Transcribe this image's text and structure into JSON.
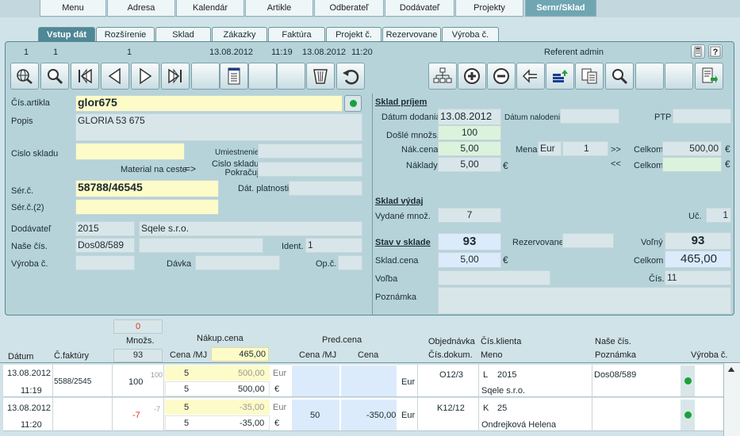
{
  "top_tabs": [
    {
      "label": "Menu"
    },
    {
      "label": "Adresa"
    },
    {
      "label": "Kalendár"
    },
    {
      "label": "Artikle"
    },
    {
      "label": "Odberateľ"
    },
    {
      "label": "Dodávateľ"
    },
    {
      "label": "Projekty"
    },
    {
      "label": "Sernr/Sklad"
    }
  ],
  "sub_tabs": [
    {
      "label": "Vstup dát"
    },
    {
      "label": "Rozšírenie"
    },
    {
      "label": "Sklad"
    },
    {
      "label": "Zákazky"
    },
    {
      "label": "Faktúra"
    },
    {
      "label": "Projekt č."
    },
    {
      "label": "Rezervovane"
    },
    {
      "label": "Výroba č."
    }
  ],
  "header": {
    "n1": "1",
    "n2": "1",
    "n3": "1",
    "date1": "13.08.2012",
    "time1": "11:19",
    "date2": "13.08.2012",
    "time2": "11:20",
    "referent_label": "Referent",
    "referent": "admin"
  },
  "icons": {
    "left": [
      "globe-search-icon",
      "search-icon",
      "first-record-icon",
      "prev-record-icon",
      "next-record-icon",
      "last-record-icon",
      "empty-icon",
      "document-list-icon",
      "empty-icon",
      "empty-icon",
      "trash-icon",
      "undo-icon"
    ],
    "right": [
      "tree-icon",
      "add-icon",
      "remove-icon",
      "arrow-back-icon",
      "stack-up-icon",
      "copy-docs-icon",
      "search-icon",
      "empty-icon",
      "empty-icon",
      "export-icon"
    ]
  },
  "form": {
    "cis_artikla_label": "Čís.artikla",
    "cis_artikla": "glor675",
    "popis_label": "Popis",
    "popis": "GLORIA 53 675",
    "cislo_skladu_label": "Cislo skladu",
    "cislo_skladu": "",
    "umiestnenie_label": "Umiestnenie",
    "umiestnenie": "",
    "material_label": "Material na ceste",
    "material_arrow": "=>",
    "cislo_skladu2_label": "Cislo skladu",
    "pokracuj_label": "Pokračuj",
    "cislo_skladu2": "",
    "ser_label": "Sér.č.",
    "ser": "58788/46545",
    "dat_platnosti_label": "Dát. platnosti",
    "dat_platnosti": "",
    "ser2_label": "Sér.č.(2)",
    "ser2": "",
    "dodavatel_label": "Dodávateľ",
    "dodavatel_cis": "2015",
    "dodavatel_name": "Sqele s.r.o.",
    "nase_cis_label": "Naše čís.",
    "nase_cis": "Dos08/589",
    "ident_label": "Ident.",
    "ident": "1",
    "vyroba_label": "Výroba č.",
    "vyroba": "",
    "davka_label": "Dávka",
    "davka": "",
    "opc_label": "Op.č.",
    "opc": ""
  },
  "prijem": {
    "title": "Sklad príjem",
    "datum_dodania_label": "Dátum dodania",
    "datum_dodania": "13.08.2012",
    "datum_nalodenia_label": "Dátum nalodenia",
    "datum_nalodenia": "",
    "ptp_label": "PTP",
    "ptp": "",
    "dosle_label": "Došlé množs.",
    "dosle": "100",
    "nak_cena_label": "Nák.cena",
    "nak_cena": "5,00",
    "mena_label": "Mena",
    "mena": "Eur",
    "mena_val": "1",
    "fwd": ">>",
    "back": "<<",
    "celkom_label": "Celkom",
    "celkom": "500,00",
    "eur1": "€",
    "eur2": "€",
    "eur3": "€",
    "naklady_label": "Náklady",
    "naklady": "5,00",
    "celkom2_label": "Celkom",
    "celkom2": ""
  },
  "vydaj": {
    "title": "Sklad výdaj",
    "vydane_label": "Vydané množ.",
    "vydane": "7",
    "uct_label": "Uč.",
    "uct": "1"
  },
  "stav": {
    "title": "Stav v sklade",
    "stav": "93",
    "rezerv_label": "Rezervovane",
    "rezerv": "",
    "volny_label": "Voľný",
    "volny": "93",
    "sklad_cena_label": "Sklad.cena",
    "sklad_cena": "5,00",
    "eur": "€",
    "celkom_label": "Celkom",
    "celkom": "465,00",
    "volba_label": "Voľba",
    "volba": "",
    "cis_label": "Čís.",
    "cis": "11",
    "poznamka_label": "Poznámka",
    "poznamka": ""
  },
  "grid": {
    "top_count": "0",
    "mnozs_label": "Množs.",
    "mnozs_total": "93",
    "nakup_label": "Nákup.cena",
    "cena_mj_label": "Cena /MJ",
    "cena_total": "465,00",
    "pred_label": "Pred.cena",
    "pred_cena_mj_label": "Cena /MJ",
    "pred_cena_label": "Cena",
    "objednavka_label": "Objednávka",
    "cis_dokum_label": "Čís.dokum.",
    "cis_klienta_label": "Čís.klienta",
    "meno_label": "Meno",
    "nase_cis_label": "Naše čís.",
    "poznamka_label": "Poznámka",
    "vyroba_label": "Výroba č.",
    "datum_label": "Dátum",
    "cfaktury_label": "Č.faktúry",
    "rows": [
      {
        "date": "13.08.2012",
        "time": "11:19",
        "faktura": "5588/2545",
        "qty": "100",
        "qty_small": "100",
        "cena1": "5",
        "cena2": "5",
        "tot1": "500,00",
        "tot2": "500,00",
        "cur1": "Eur",
        "cur2": "€",
        "pred_mj": "",
        "pred_cena": "",
        "pred_cur": "Eur",
        "obj": "O12/3",
        "klient_t": "L",
        "klient": "2015",
        "meno": "Sqele s.r.o.",
        "nase": "Dos08/589"
      },
      {
        "date": "13.08.2012",
        "time": "11:20",
        "faktura": "",
        "qty": "-7",
        "qty_small": "-7",
        "cena1": "5",
        "cena2": "5",
        "tot1": "-35,00",
        "tot2": "-35,00",
        "cur1": "Eur",
        "cur2": "€",
        "pred_mj": "50",
        "pred_cena": "-350,00",
        "pred_cur": "Eur",
        "obj": "K12/12",
        "klient_t": "K",
        "klient": "25",
        "meno": "Ondrejková Helena",
        "nase": ""
      }
    ]
  }
}
